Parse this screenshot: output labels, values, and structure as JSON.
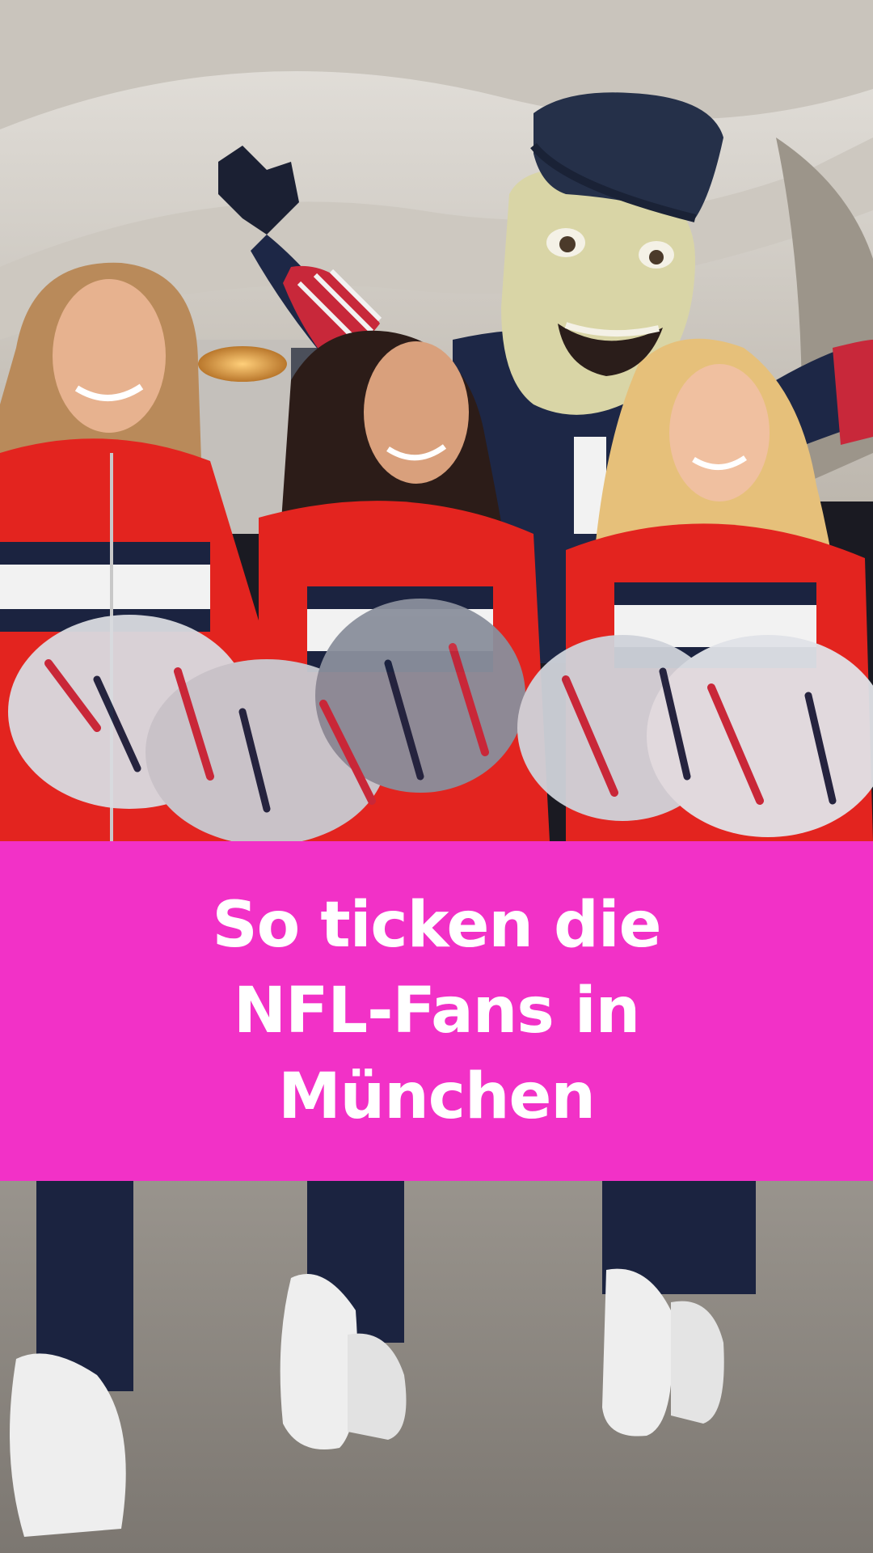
{
  "overlay": {
    "background_color": "#f231c7",
    "text_color": "#ffffff",
    "lines": [
      "So ticken die",
      "NFL-Fans in",
      "München"
    ]
  },
  "scene": {
    "colors": {
      "jacket_red": "#e3241f",
      "jacket_navy": "#1b2340",
      "mascot_face": "#d9d5a6",
      "hat_navy": "#253049",
      "ceiling": "#d7d3cc",
      "floor": "#8f8a84"
    }
  }
}
